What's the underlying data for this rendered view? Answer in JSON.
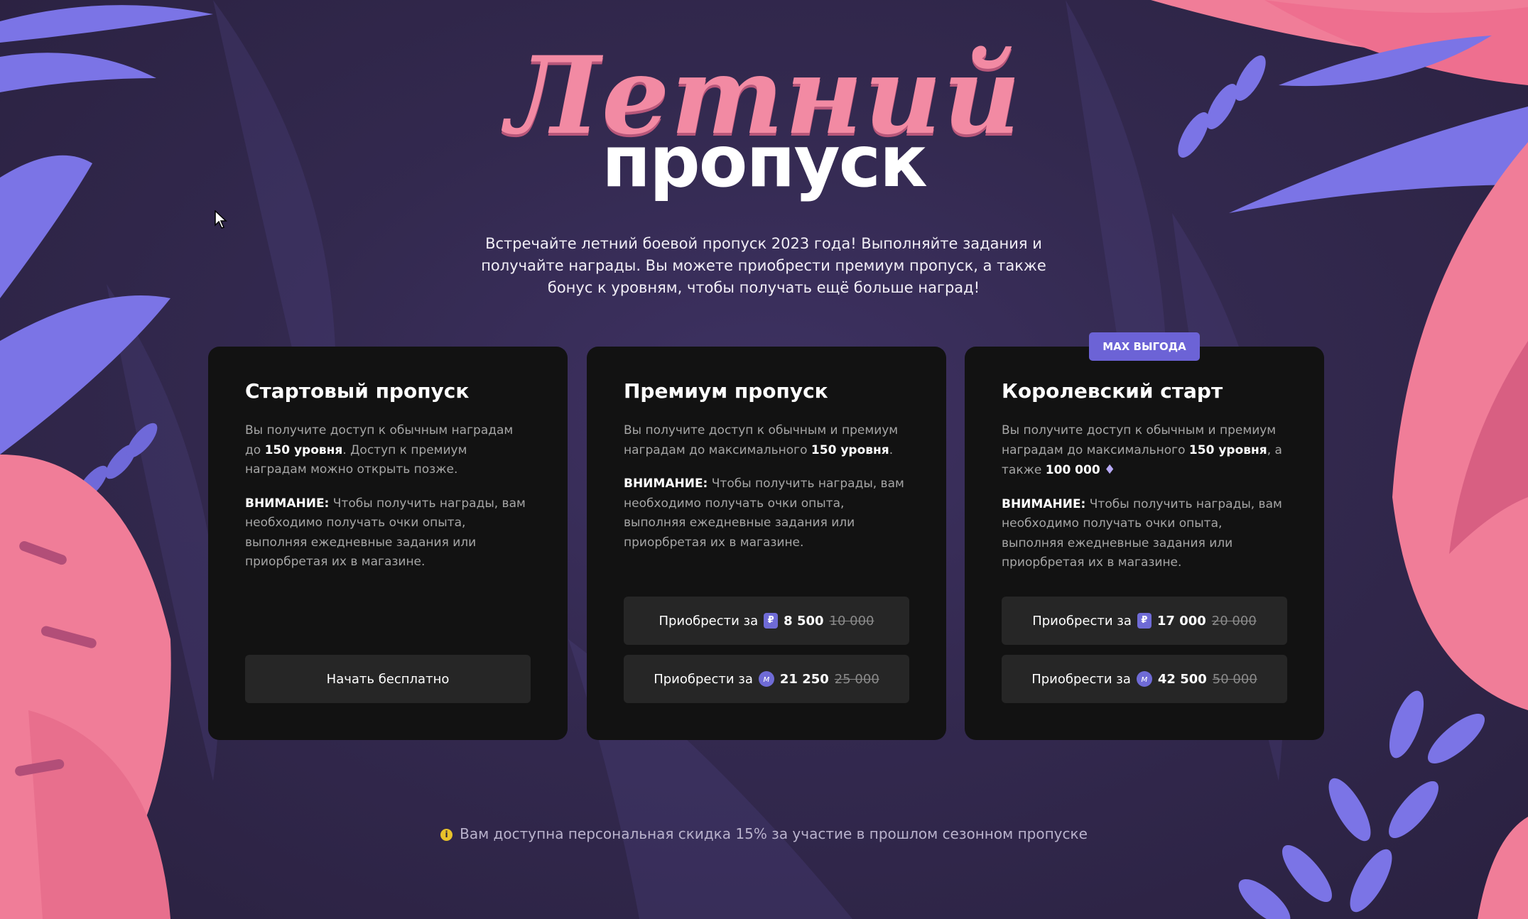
{
  "title": {
    "script": "Летний",
    "main": "пропуск"
  },
  "subtitle": "Встречайте летний боевой пропуск 2023 года! Выполняйте задания и получайте награды. Вы можете приобрести премиум пропуск, а также бонус к уровням, чтобы получать ещё больше наград!",
  "badge": "МАХ ВЫГОДА",
  "cards": [
    {
      "title": "Стартовый пропуск",
      "desc_pre": "Вы получите доступ к обычным наградам до ",
      "desc_bold": "150 уровня",
      "desc_post": ". Доступ к премиум наградам можно открыть позже.",
      "warn_label": "ВНИМАНИЕ:",
      "warn_text": " Чтобы получить награды, вам необходимо получать очки опыта, выполняя ежедневные задания или приорбретая их в магазине.",
      "buttons": [
        {
          "label": "Начать бесплатно"
        }
      ]
    },
    {
      "title": "Премиум пропуск",
      "desc_pre": "Вы получите доступ к обычным и премиум наградам до максимального ",
      "desc_bold": "150 уровня",
      "desc_post": ".",
      "warn_label": "ВНИМАНИЕ:",
      "warn_text": " Чтобы получить награды, вам необходимо получать очки опыта, выполняя ежедневные задания или приорбретая их в магазине.",
      "buttons": [
        {
          "label": "Приобрести за",
          "icon": "rub-currency-icon",
          "icon_glyph": "₽",
          "amount": "8 500",
          "old": "10 000"
        },
        {
          "label": "Приобрести за",
          "icon": "coin-currency-icon",
          "icon_glyph": "м",
          "amount": "21 250",
          "old": "25 000"
        }
      ]
    },
    {
      "title": "Королевский старт",
      "desc_pre": "Вы получите доступ к обычным и премиум наградам до максимального ",
      "desc_bold": "150 уровня",
      "desc_post": ", а также ",
      "desc_bold2": "100 000",
      "desc_gem": "♦",
      "warn_label": "ВНИМАНИЕ:",
      "warn_text": " Чтобы получить награды, вам необходимо получать очки опыта, выполняя ежедневные задания или приорбретая их в магазине.",
      "buttons": [
        {
          "label": "Приобрести за",
          "icon": "rub-currency-icon",
          "icon_glyph": "₽",
          "amount": "17 000",
          "old": "20 000"
        },
        {
          "label": "Приобрести за",
          "icon": "coin-currency-icon",
          "icon_glyph": "м",
          "amount": "42 500",
          "old": "50 000"
        }
      ]
    }
  ],
  "notice": {
    "icon": "info-icon",
    "icon_glyph": "i",
    "text": "Вам доступна персональная скидка 15% за участие в прошлом сезонном пропуске"
  },
  "colors": {
    "accent": "#6c63d6",
    "pink": "#f28aa3",
    "card": "#121212",
    "button": "#262626"
  }
}
